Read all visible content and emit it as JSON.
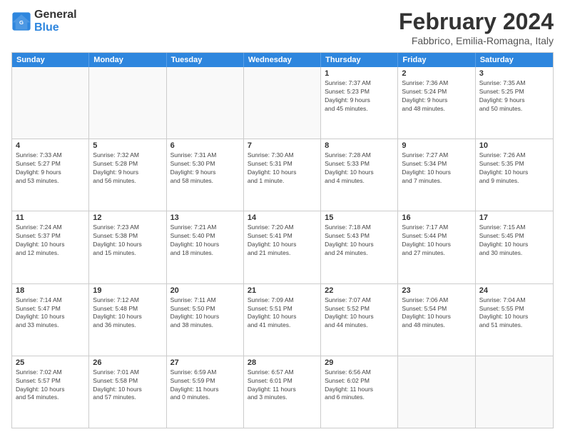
{
  "logo": {
    "line1": "General",
    "line2": "Blue"
  },
  "title": "February 2024",
  "subtitle": "Fabbrico, Emilia-Romagna, Italy",
  "weekdays": [
    "Sunday",
    "Monday",
    "Tuesday",
    "Wednesday",
    "Thursday",
    "Friday",
    "Saturday"
  ],
  "rows": [
    [
      {
        "day": "",
        "info": ""
      },
      {
        "day": "",
        "info": ""
      },
      {
        "day": "",
        "info": ""
      },
      {
        "day": "",
        "info": ""
      },
      {
        "day": "1",
        "info": "Sunrise: 7:37 AM\nSunset: 5:23 PM\nDaylight: 9 hours\nand 45 minutes."
      },
      {
        "day": "2",
        "info": "Sunrise: 7:36 AM\nSunset: 5:24 PM\nDaylight: 9 hours\nand 48 minutes."
      },
      {
        "day": "3",
        "info": "Sunrise: 7:35 AM\nSunset: 5:25 PM\nDaylight: 9 hours\nand 50 minutes."
      }
    ],
    [
      {
        "day": "4",
        "info": "Sunrise: 7:33 AM\nSunset: 5:27 PM\nDaylight: 9 hours\nand 53 minutes."
      },
      {
        "day": "5",
        "info": "Sunrise: 7:32 AM\nSunset: 5:28 PM\nDaylight: 9 hours\nand 56 minutes."
      },
      {
        "day": "6",
        "info": "Sunrise: 7:31 AM\nSunset: 5:30 PM\nDaylight: 9 hours\nand 58 minutes."
      },
      {
        "day": "7",
        "info": "Sunrise: 7:30 AM\nSunset: 5:31 PM\nDaylight: 10 hours\nand 1 minute."
      },
      {
        "day": "8",
        "info": "Sunrise: 7:28 AM\nSunset: 5:33 PM\nDaylight: 10 hours\nand 4 minutes."
      },
      {
        "day": "9",
        "info": "Sunrise: 7:27 AM\nSunset: 5:34 PM\nDaylight: 10 hours\nand 7 minutes."
      },
      {
        "day": "10",
        "info": "Sunrise: 7:26 AM\nSunset: 5:35 PM\nDaylight: 10 hours\nand 9 minutes."
      }
    ],
    [
      {
        "day": "11",
        "info": "Sunrise: 7:24 AM\nSunset: 5:37 PM\nDaylight: 10 hours\nand 12 minutes."
      },
      {
        "day": "12",
        "info": "Sunrise: 7:23 AM\nSunset: 5:38 PM\nDaylight: 10 hours\nand 15 minutes."
      },
      {
        "day": "13",
        "info": "Sunrise: 7:21 AM\nSunset: 5:40 PM\nDaylight: 10 hours\nand 18 minutes."
      },
      {
        "day": "14",
        "info": "Sunrise: 7:20 AM\nSunset: 5:41 PM\nDaylight: 10 hours\nand 21 minutes."
      },
      {
        "day": "15",
        "info": "Sunrise: 7:18 AM\nSunset: 5:43 PM\nDaylight: 10 hours\nand 24 minutes."
      },
      {
        "day": "16",
        "info": "Sunrise: 7:17 AM\nSunset: 5:44 PM\nDaylight: 10 hours\nand 27 minutes."
      },
      {
        "day": "17",
        "info": "Sunrise: 7:15 AM\nSunset: 5:45 PM\nDaylight: 10 hours\nand 30 minutes."
      }
    ],
    [
      {
        "day": "18",
        "info": "Sunrise: 7:14 AM\nSunset: 5:47 PM\nDaylight: 10 hours\nand 33 minutes."
      },
      {
        "day": "19",
        "info": "Sunrise: 7:12 AM\nSunset: 5:48 PM\nDaylight: 10 hours\nand 36 minutes."
      },
      {
        "day": "20",
        "info": "Sunrise: 7:11 AM\nSunset: 5:50 PM\nDaylight: 10 hours\nand 38 minutes."
      },
      {
        "day": "21",
        "info": "Sunrise: 7:09 AM\nSunset: 5:51 PM\nDaylight: 10 hours\nand 41 minutes."
      },
      {
        "day": "22",
        "info": "Sunrise: 7:07 AM\nSunset: 5:52 PM\nDaylight: 10 hours\nand 44 minutes."
      },
      {
        "day": "23",
        "info": "Sunrise: 7:06 AM\nSunset: 5:54 PM\nDaylight: 10 hours\nand 48 minutes."
      },
      {
        "day": "24",
        "info": "Sunrise: 7:04 AM\nSunset: 5:55 PM\nDaylight: 10 hours\nand 51 minutes."
      }
    ],
    [
      {
        "day": "25",
        "info": "Sunrise: 7:02 AM\nSunset: 5:57 PM\nDaylight: 10 hours\nand 54 minutes."
      },
      {
        "day": "26",
        "info": "Sunrise: 7:01 AM\nSunset: 5:58 PM\nDaylight: 10 hours\nand 57 minutes."
      },
      {
        "day": "27",
        "info": "Sunrise: 6:59 AM\nSunset: 5:59 PM\nDaylight: 11 hours\nand 0 minutes."
      },
      {
        "day": "28",
        "info": "Sunrise: 6:57 AM\nSunset: 6:01 PM\nDaylight: 11 hours\nand 3 minutes."
      },
      {
        "day": "29",
        "info": "Sunrise: 6:56 AM\nSunset: 6:02 PM\nDaylight: 11 hours\nand 6 minutes."
      },
      {
        "day": "",
        "info": ""
      },
      {
        "day": "",
        "info": ""
      }
    ]
  ]
}
